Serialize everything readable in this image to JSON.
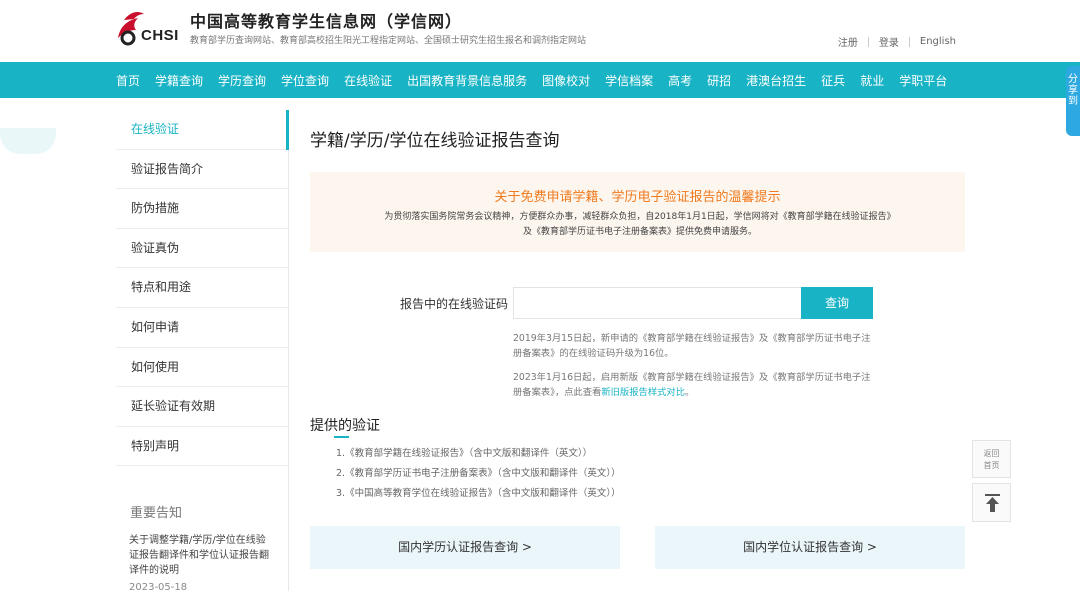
{
  "header": {
    "logo_text": "CHSI",
    "site_title": "中国高等教育学生信息网（学信网）",
    "subtitle": "教育部学历查询网站、教育部高校招生阳光工程指定网站、全国硕士研究生招生报名和调剂指定网站",
    "links": [
      "注册",
      "登录",
      "English"
    ]
  },
  "nav": [
    "首页",
    "学籍查询",
    "学历查询",
    "学位查询",
    "在线验证",
    "出国教育背景信息服务",
    "图像校对",
    "学信档案",
    "高考",
    "研招",
    "港澳台招生",
    "征兵",
    "就业",
    "学职平台"
  ],
  "share_tab": "分享到",
  "sidebar": {
    "items": [
      "在线验证",
      "验证报告简介",
      "防伪措施",
      "验证真伪",
      "特点和用途",
      "如何申请",
      "如何使用",
      "延长验证有效期",
      "特别声明"
    ],
    "notice_title": "重要告知",
    "notice_text": "关于调整学籍/学历/学位在线验证报告翻译件和学位认证报告翻译件的说明",
    "notice_date": "2023-05-18"
  },
  "main": {
    "title": "学籍/学历/学位在线验证报告查询",
    "tip_title": "关于免费申请学籍、学历电子验证报告的温馨提示",
    "tip_body": "为贯彻落实国务院常务会议精神，方便群众办事，减轻群众负担，自2018年1月1日起，学信网将对《教育部学籍在线验证报告》及《教育部学历证书电子注册备案表》提供免费申请服务。",
    "query_label": "报告中的在线验证码",
    "query_value": "",
    "query_button": "查询",
    "note1": "2019年3月15日起，新申请的《教育部学籍在线验证报告》及《教育部学历证书电子注册备案表》的在线验证码升级为16位。",
    "note2_prefix": "2023年1月16日起，启用新版《教育部学籍在线验证报告》及《教育部学历证书电子注册备案表》，点此查看",
    "note2_link": "新旧版报告样式对比",
    "note2_suffix": "。",
    "provided_title": "提供的验证",
    "provided_list": [
      "1.《教育部学籍在线验证报告》（含中文版和翻译件（英文））",
      "2.《教育部学历证书电子注册备案表》（含中文版和翻译件（英文））",
      "3.《中国高等教育学位在线验证报告》（含中文版和翻译件（英文））"
    ],
    "btn_xueli": "国内学历认证报告查询 >",
    "btn_xuewei": "国内学位认证报告查询 >"
  },
  "float": {
    "home_label": "返回首页"
  },
  "colors": {
    "accent": "#18b3c4",
    "tip_title": "#f07a1e",
    "tip_bg": "#fdf6ee"
  }
}
